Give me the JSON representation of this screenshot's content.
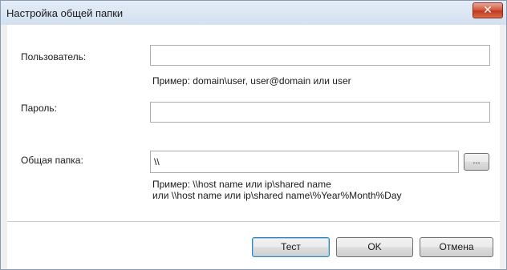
{
  "window": {
    "title": "Настройка общей папки",
    "close_glyph": "✕"
  },
  "form": {
    "user_label": "Пользователь:",
    "user_value": "",
    "user_hint": "Пример: domain\\user, user@domain или user",
    "password_label": "Пароль:",
    "password_value": "",
    "folder_label": "Общая папка:",
    "folder_value": "\\\\",
    "browse_label": "...",
    "folder_hint_line1": "Пример: \\\\host name или ip\\shared name",
    "folder_hint_line2": "или \\\\host name или ip\\shared name\\%Year%Month%Day"
  },
  "buttons": {
    "test": "Тест",
    "ok": "OK",
    "cancel": "Отмена"
  },
  "colors": {
    "title_bar": "#dce7f5",
    "close_button": "#c7432a",
    "default_button_border": "#3c7fb1"
  }
}
